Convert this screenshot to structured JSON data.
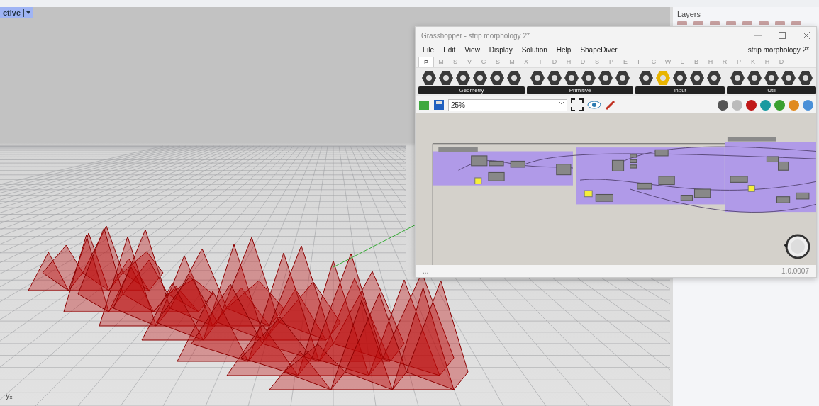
{
  "viewport": {
    "label": "ctive",
    "axis_labels": [
      "y",
      "x"
    ]
  },
  "layers_panel": {
    "title": "Layers"
  },
  "grasshopper": {
    "title": "Grasshopper - strip morphology 2*",
    "menu": [
      "File",
      "Edit",
      "View",
      "Display",
      "Solution",
      "Help",
      "ShapeDiver"
    ],
    "document": "strip morphology 2*",
    "tabs": [
      {
        "label": "P",
        "selected": true
      },
      {
        "label": "M",
        "selected": false
      },
      {
        "label": "S",
        "selected": false
      },
      {
        "label": "V",
        "selected": false
      },
      {
        "label": "C",
        "selected": false
      },
      {
        "label": "S",
        "selected": false
      },
      {
        "label": "M",
        "selected": false
      },
      {
        "label": "X",
        "selected": false
      },
      {
        "label": "T",
        "selected": false
      },
      {
        "label": "D",
        "selected": false
      },
      {
        "label": "H",
        "selected": false
      },
      {
        "label": "D",
        "selected": false
      },
      {
        "label": "S",
        "selected": false
      },
      {
        "label": "P",
        "selected": false
      },
      {
        "label": "E",
        "selected": false
      },
      {
        "label": "F",
        "selected": false
      },
      {
        "label": "C",
        "selected": false
      },
      {
        "label": "W",
        "selected": false
      },
      {
        "label": "L",
        "selected": false
      },
      {
        "label": "B",
        "selected": false
      },
      {
        "label": "H",
        "selected": false
      },
      {
        "label": "R",
        "selected": false
      },
      {
        "label": "P",
        "selected": false
      },
      {
        "label": "K",
        "selected": false
      },
      {
        "label": "H",
        "selected": false
      },
      {
        "label": "D",
        "selected": false
      }
    ],
    "groups": [
      {
        "label": "Geometry"
      },
      {
        "label": "Primitive"
      },
      {
        "label": "Input"
      },
      {
        "label": "Util"
      }
    ],
    "zoom": {
      "value": "25%"
    },
    "status": {
      "left": "...",
      "version": "1.0.0007"
    }
  }
}
